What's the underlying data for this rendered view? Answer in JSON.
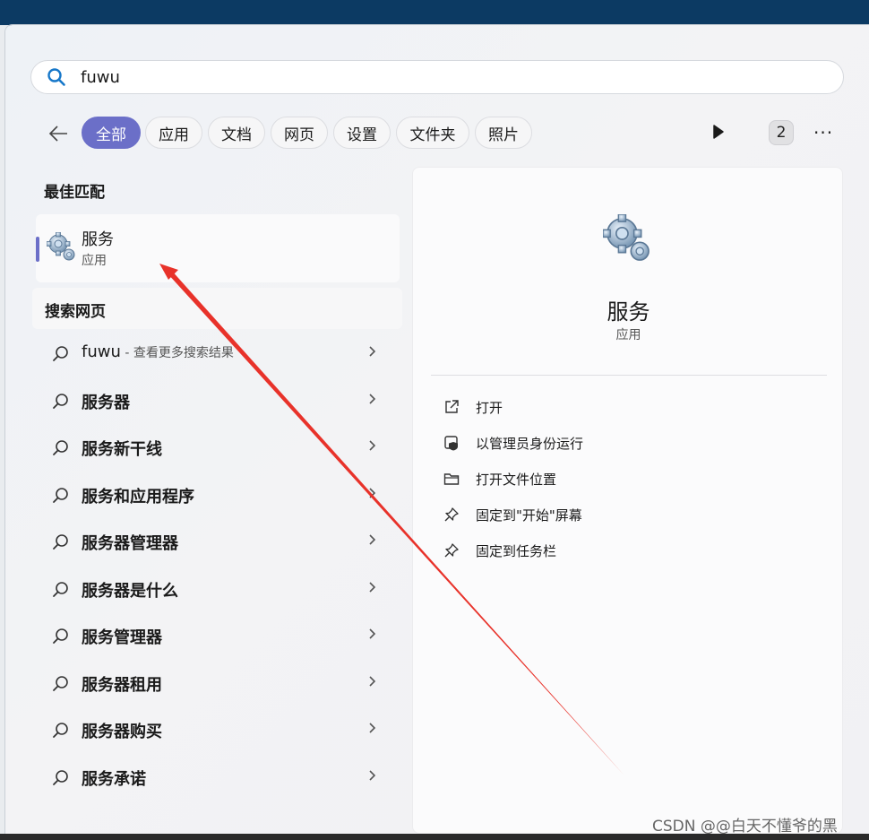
{
  "search": {
    "query": "fuwu"
  },
  "filters": {
    "chips": [
      {
        "label": "全部",
        "active": true
      },
      {
        "label": "应用",
        "active": false
      },
      {
        "label": "文档",
        "active": false
      },
      {
        "label": "网页",
        "active": false
      },
      {
        "label": "设置",
        "active": false
      },
      {
        "label": "文件夹",
        "active": false
      },
      {
        "label": "照片",
        "active": false
      }
    ],
    "badge": "2",
    "more": "···"
  },
  "best_match": {
    "section_title": "最佳匹配",
    "name": "服务",
    "type": "应用"
  },
  "web": {
    "section_title": "搜索网页",
    "first": {
      "query": "fuwu",
      "hint": " - 查看更多搜索结果"
    },
    "items": [
      "服务器",
      "服务新干线",
      "服务和应用程序",
      "服务器管理器",
      "服务器是什么",
      "服务管理器",
      "服务器租用",
      "服务器购买",
      "服务承诺"
    ]
  },
  "details": {
    "title": "服务",
    "subtitle": "应用",
    "actions": [
      {
        "label": "打开",
        "icon": "open-external-icon"
      },
      {
        "label": "以管理员身份运行",
        "icon": "shield-admin-icon"
      },
      {
        "label": "打开文件位置",
        "icon": "folder-icon"
      },
      {
        "label": "固定到\"开始\"屏幕",
        "icon": "pin-icon"
      },
      {
        "label": "固定到任务栏",
        "icon": "pin-icon"
      }
    ]
  },
  "colors": {
    "accent": "#6b6fc8",
    "annotation_arrow": "#e8322a"
  },
  "watermark": "CSDN @@白天不懂爷的黑"
}
